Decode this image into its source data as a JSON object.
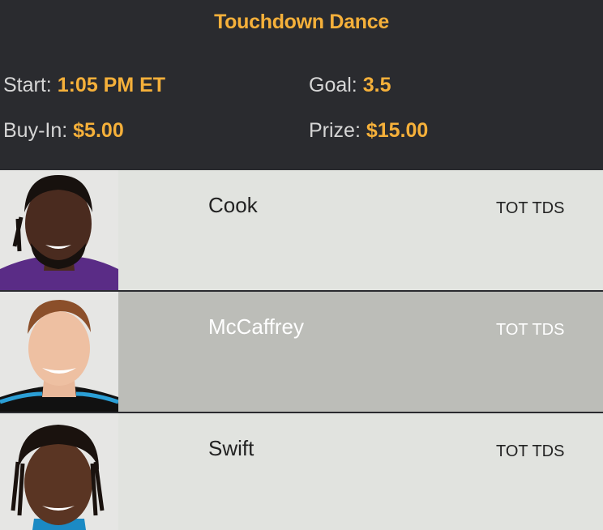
{
  "contest": {
    "title": "Touchdown Dance",
    "start_label": "Start:",
    "start_value": "1:05 PM ET",
    "goal_label": "Goal:",
    "goal_value": "3.5",
    "buyin_label": "Buy-In:",
    "buyin_value": "$5.00",
    "prize_label": "Prize:",
    "prize_value": "$15.00"
  },
  "players": [
    {
      "name": "Cook",
      "stat": "TOT TDS"
    },
    {
      "name": "McCaffrey",
      "stat": "TOT TDS"
    },
    {
      "name": "Swift",
      "stat": "TOT TDS"
    }
  ],
  "colors": {
    "header_bg": "#2a2b2f",
    "accent": "#f5b03a",
    "label": "#d6d6d6",
    "row_light": "#e1e3df",
    "row_selected": "#bcbdb8"
  }
}
